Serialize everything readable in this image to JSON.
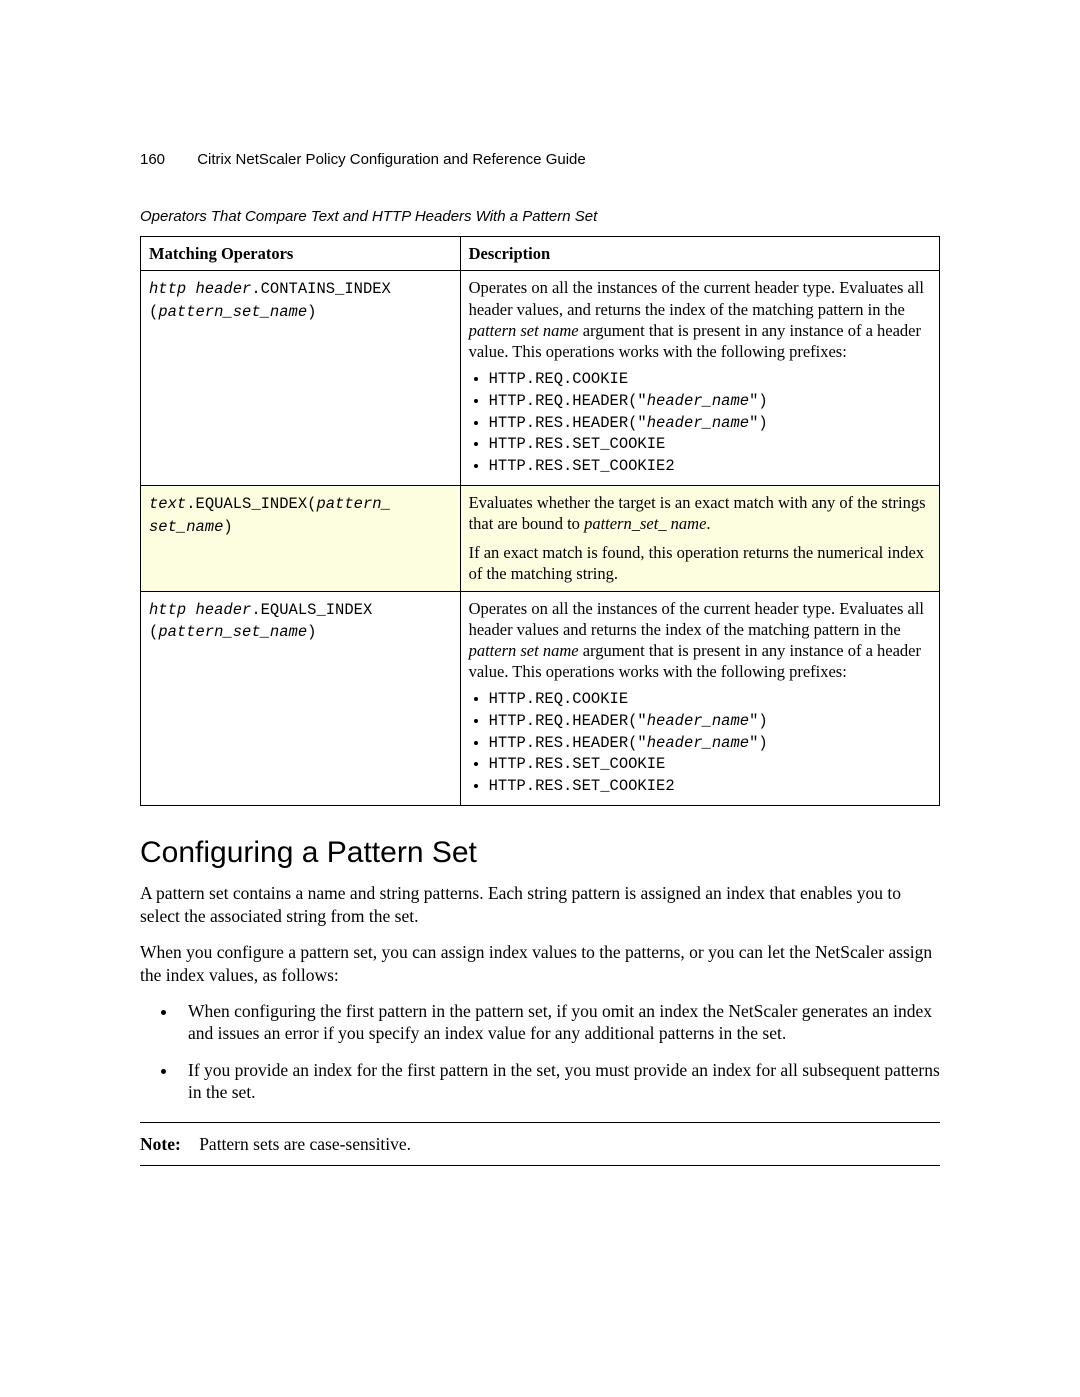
{
  "header": {
    "page_number": "160",
    "running_title": "Citrix NetScaler Policy Configuration and Reference Guide"
  },
  "table": {
    "caption": "Operators That Compare Text and HTTP Headers With a Pattern Set",
    "col1": "Matching Operators",
    "col2": "Description",
    "rows": [
      {
        "op_prefix": "http header",
        "op_name": ".CONTAINS_INDEX",
        "op_open": "(",
        "op_arg": "pattern_set_name",
        "op_close": ")",
        "desc_intro_a": "Operates on all the instances of the current header type. Evaluates all header values, and returns the index of the matching pattern in the ",
        "desc_italic": "pattern set name",
        "desc_intro_b": " argument that is present in any instance of a header value. This operations works with the following prefixes:",
        "prefixes": [
          {
            "a": "HTTP.REQ.COOKIE"
          },
          {
            "a": "HTTP.REQ.HEADER(\"",
            "i": "header_name",
            "b": "\")"
          },
          {
            "a": "HTTP.RES.HEADER(\"",
            "i": "header_name",
            "b": "\")"
          },
          {
            "a": "HTTP.RES.SET_COOKIE"
          },
          {
            "a": "HTTP.RES.SET_COOKIE2"
          }
        ],
        "highlight": false
      },
      {
        "op_prefix": "text",
        "op_name": ".EQUALS_INDEX(",
        "op_arg": "pattern_ set_name",
        "op_close": ")",
        "desc_p1_a": "Evaluates whether the target is an exact match with any of the strings that are bound to ",
        "desc_p1_i": "pattern_set_ name",
        "desc_p1_b": ".",
        "desc_p2": "If an exact match is found, this operation returns the numerical index of the matching string.",
        "highlight": true
      },
      {
        "op_prefix": "http header",
        "op_name": ".EQUALS_INDEX",
        "op_open": "(",
        "op_arg": "pattern_set_name",
        "op_close": ")",
        "desc_intro_a": "Operates on all the instances of the current header type. Evaluates all header values and returns the index of the matching pattern in the ",
        "desc_italic": "pattern set name",
        "desc_intro_b": " argument that is present in any instance of a header value. This operations works with the following prefixes:",
        "prefixes": [
          {
            "a": "HTTP.REQ.COOKIE"
          },
          {
            "a": "HTTP.REQ.HEADER(\"",
            "i": "header_name",
            "b": "\")"
          },
          {
            "a": "HTTP.RES.HEADER(\"",
            "i": "header_name",
            "b": "\")"
          },
          {
            "a": "HTTP.RES.SET_COOKIE"
          },
          {
            "a": "HTTP.RES.SET_COOKIE2"
          }
        ],
        "highlight": false
      }
    ]
  },
  "section": {
    "title": "Configuring a Pattern Set",
    "p1": "A pattern set contains a name and string patterns. Each string pattern is assigned an index that enables you to select the associated string from the set.",
    "p2": "When you configure a pattern set, you can assign index values to the patterns, or you can let the NetScaler assign the index values, as follows:",
    "bullets": [
      "When configuring the first pattern in the pattern set, if you omit an index the NetScaler generates an index and issues an error if you specify an index value for any additional patterns in the set.",
      "If you provide an index for the first pattern in the set, you must provide an index for all subsequent patterns in the set."
    ],
    "note_label": "Note:",
    "note_text": "Pattern sets are case-sensitive."
  }
}
